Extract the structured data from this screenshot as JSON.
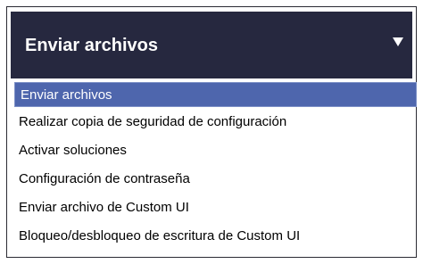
{
  "dropdown": {
    "selected_label": "Enviar archivos",
    "options": [
      "Enviar archivos",
      "Realizar copia de seguridad de configuración",
      "Activar soluciones",
      "Configuración de contraseña",
      "Enviar archivo de Custom UI",
      "Bloqueo/desbloqueo de escritura de Custom UI"
    ],
    "selected_index": 0
  },
  "colors": {
    "header_bg": "#26283f",
    "selected_bg": "#4e66ad"
  },
  "icons": {
    "toggle": "chevron-down-icon"
  }
}
